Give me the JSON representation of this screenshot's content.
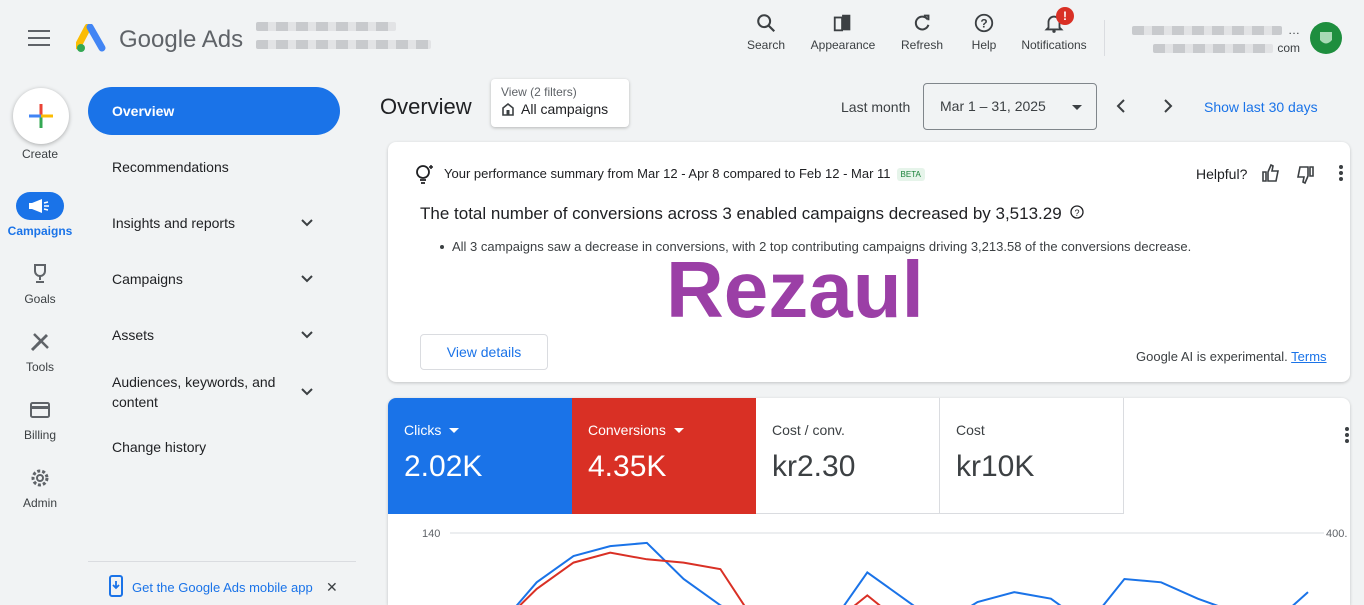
{
  "header": {
    "brand": "Google Ads",
    "toolbar": [
      {
        "label": "Search",
        "icon": "search-icon"
      },
      {
        "label": "Appearance",
        "icon": "appearance-icon"
      },
      {
        "label": "Refresh",
        "icon": "refresh-icon"
      },
      {
        "label": "Help",
        "icon": "help-icon"
      },
      {
        "label": "Notifications",
        "icon": "bell-icon",
        "badge": "!"
      }
    ],
    "account_right_line1": "…",
    "account_right_line2": "com"
  },
  "rail": {
    "create": "Create",
    "campaigns": "Campaigns",
    "goals": "Goals",
    "tools": "Tools",
    "billing": "Billing",
    "admin": "Admin"
  },
  "nav": {
    "items": [
      {
        "label": "Overview"
      },
      {
        "label": "Recommendations"
      },
      {
        "label": "Insights and reports"
      },
      {
        "label": "Campaigns"
      },
      {
        "label": "Assets"
      },
      {
        "label": "Audiences, keywords, and content"
      },
      {
        "label": "Change history"
      }
    ],
    "footer_link": "Get the Google Ads mobile app",
    "footer_close": "✕"
  },
  "main": {
    "title": "Overview",
    "view_small": "View (2 filters)",
    "view_big": "All campaigns",
    "last_month": "Last month",
    "date_range": "Mar 1 – 31, 2025",
    "show_last": "Show last 30 days"
  },
  "summary_card": {
    "summary": "Your performance summary from Mar 12 - Apr 8 compared to Feb 12 - Mar 11",
    "beta": "BETA",
    "helpful": "Helpful?",
    "headline": "The total number of conversions across 3 enabled campaigns decreased by 3,513.29",
    "bullet": "All 3 campaigns saw a decrease in conversions, with 2 top contributing campaigns driving 3,213.58 of the conversions decrease.",
    "watermark": "Rezaul",
    "view_details": "View details",
    "ai_note": "Google AI is experimental.",
    "terms": "Terms"
  },
  "metrics": [
    {
      "label": "Clicks",
      "value": "2.02K",
      "bg": "#1a73e8",
      "fg": "#ffffff",
      "dropdown": true
    },
    {
      "label": "Conversions",
      "value": "4.35K",
      "bg": "#d93025",
      "fg": "#ffffff",
      "dropdown": true
    },
    {
      "label": "Cost / conv.",
      "value": "kr2.30",
      "bg": "#ffffff",
      "fg": "#3c4043",
      "dropdown": false
    },
    {
      "label": "Cost",
      "value": "kr10K",
      "bg": "#ffffff",
      "fg": "#3c4043",
      "dropdown": false
    }
  ],
  "chart_data": {
    "type": "line",
    "y_left_top_label": "140",
    "y_right_top_label": "400.",
    "series": [
      {
        "color": "#1a73e8",
        "values": [
          0,
          65,
          105,
          120,
          125,
          70,
          30,
          0,
          25,
          0,
          80,
          40,
          0,
          35,
          50,
          40,
          0,
          70,
          65,
          40,
          20,
          0,
          50
        ]
      },
      {
        "color": "#d93025",
        "values": [
          0,
          55,
          95,
          110,
          100,
          95,
          85,
          0,
          0,
          0,
          45,
          0
        ]
      }
    ]
  }
}
